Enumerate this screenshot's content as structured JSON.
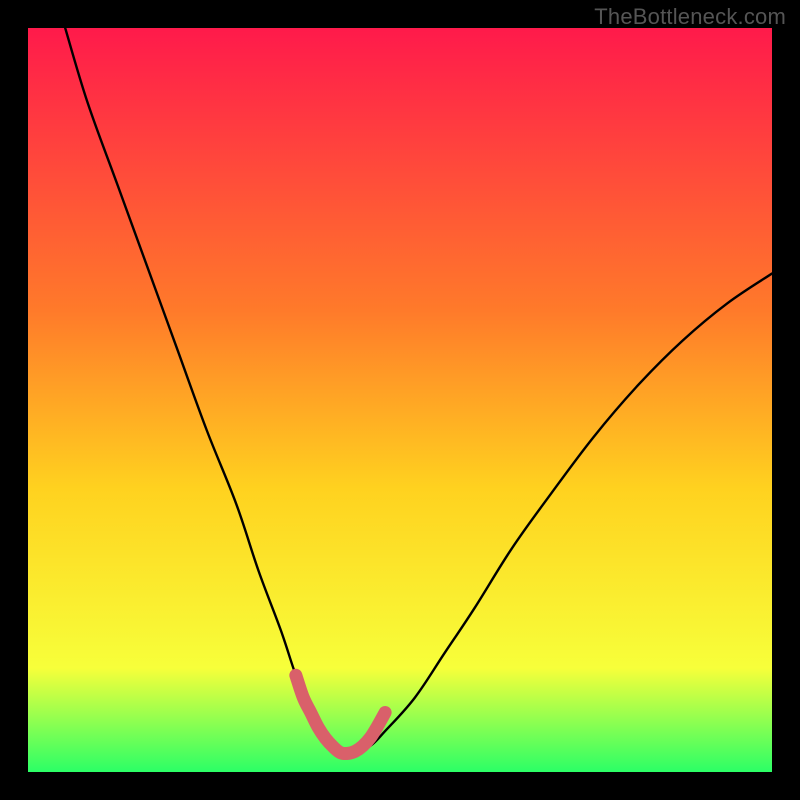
{
  "watermark": "TheBottleneck.com",
  "colors": {
    "bg": "#000000",
    "grad_top": "#ff1a4b",
    "grad_mid1": "#ff7a2a",
    "grad_mid2": "#ffd21f",
    "grad_mid3": "#f7ff3a",
    "grad_bottom": "#2bff66",
    "curve": "#000000",
    "highlight": "#d9606a"
  },
  "chart_data": {
    "type": "line",
    "title": "",
    "xlabel": "",
    "ylabel": "",
    "xlim": [
      0,
      100
    ],
    "ylim": [
      0,
      100
    ],
    "series": [
      {
        "name": "bottleneck-curve",
        "x": [
          5,
          8,
          12,
          16,
          20,
          24,
          28,
          31,
          34,
          36,
          38,
          39.5,
          41,
          42.5,
          44,
          46,
          48,
          52,
          56,
          60,
          65,
          70,
          76,
          82,
          88,
          94,
          100
        ],
        "y": [
          100,
          90,
          79,
          68,
          57,
          46,
          36,
          27,
          19,
          13,
          8,
          5,
          3,
          2.4,
          2.6,
          3.5,
          5.5,
          10,
          16,
          22,
          30,
          37,
          45,
          52,
          58,
          63,
          67
        ]
      },
      {
        "name": "sweet-spot-highlight",
        "x": [
          36,
          37,
          38,
          39,
          40,
          41,
          42,
          43,
          44,
          45,
          46,
          47,
          48
        ],
        "y": [
          13,
          10,
          8,
          6,
          4.5,
          3.4,
          2.6,
          2.5,
          2.8,
          3.5,
          4.6,
          6.2,
          8
        ]
      }
    ],
    "annotations": []
  }
}
